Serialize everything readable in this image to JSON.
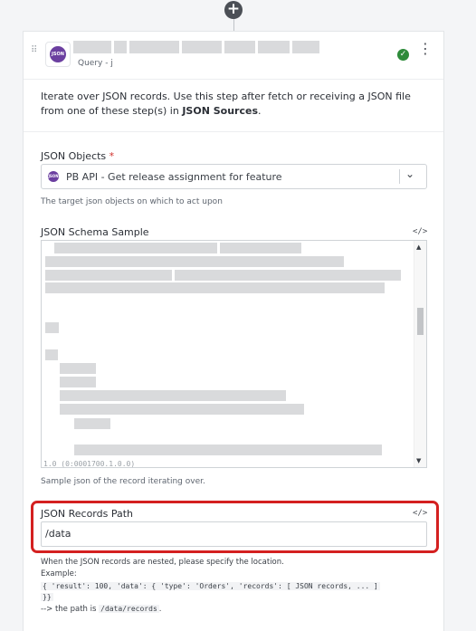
{
  "canvas": {
    "add_step_symbol": "+"
  },
  "step": {
    "app_icon_text": "JSON",
    "subtitle": "Query - j",
    "status_symbol": "✓",
    "menu_symbol": "⋮",
    "description_part1": "Iterate over JSON records. Use this step after fetch or receiving a JSON file from one of these step(s) in ",
    "description_bold": "JSON Sources",
    "description_part2": "."
  },
  "fields": {
    "json_objects": {
      "label": "JSON Objects",
      "required_mark": "*",
      "selected_value": "PB API - Get release assignment for feature",
      "help": "The target json objects on which to act upon"
    },
    "json_schema_sample": {
      "label": "JSON Schema Sample",
      "code_toggle": "</>",
      "partial_visible_text": "1.0 (0:0001700.1.0.0)",
      "help": "Sample json of the record iterating over."
    },
    "json_records_path": {
      "label": "JSON Records Path",
      "code_toggle": "</>",
      "value": "/data",
      "help_line1": "When the JSON records are nested, please specify the location.",
      "help_line2": "Example:",
      "example_code_line1": "{ 'result': 100, 'data': { 'type': 'Orders', 'records': [ JSON records, ... ]",
      "example_code_line2": "}}",
      "path_prefix": "--> the path is ",
      "path_code": "/data/records",
      "path_suffix": "."
    }
  },
  "colors": {
    "accent_purple": "#6b3fa0",
    "status_green": "#2e8b3a",
    "highlight_red": "#d42020"
  }
}
